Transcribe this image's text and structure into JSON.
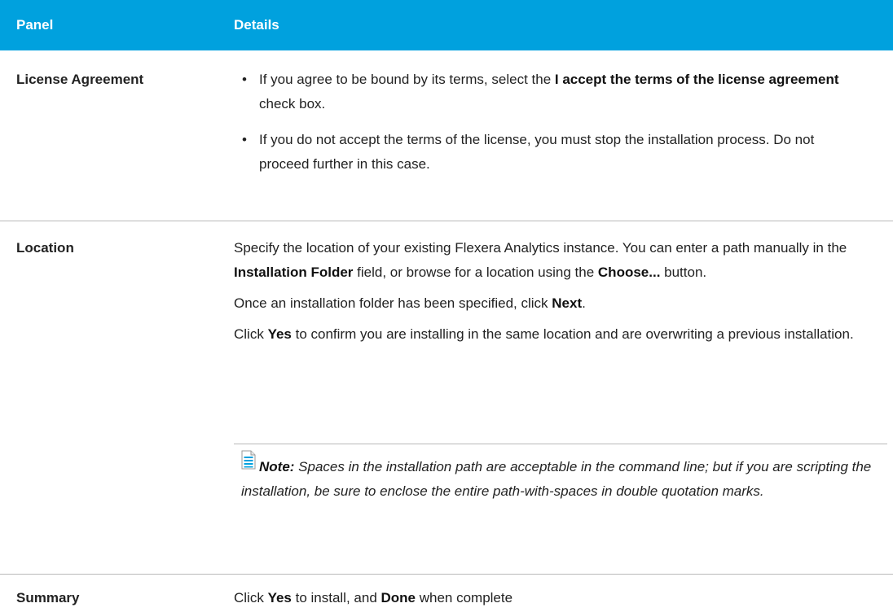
{
  "table": {
    "header": {
      "panel": "Panel",
      "details": "Details"
    },
    "rows": [
      {
        "panel": "License Agreement",
        "bullets": [
          {
            "bullet": "•",
            "t1": "If you agree to be bound by its terms, select the ",
            "b1": "I accept the terms of the license agreement",
            "t2": " check box."
          },
          {
            "bullet": "•",
            "t1": "If you do not accept the terms of the license, you must stop the installation process. Do not proceed further in this case."
          }
        ]
      },
      {
        "panel": "Location",
        "paragraphs": [
          {
            "t1": "Specify the location of your existing Flexera Analytics instance. You can enter a path manually in the ",
            "b1": "Installation Folder",
            "t2": " field, or browse for a location using the ",
            "b2": "Choose...",
            "t3": " button."
          },
          {
            "t1": "Once an installation folder has been specified, click ",
            "b1": "Next",
            "t2": "."
          },
          {
            "t1": "Click ",
            "b1": "Yes",
            "t2": " to confirm you are installing in the same location and are overwriting a previous installation."
          }
        ],
        "note": {
          "icon": "note-document-icon",
          "label": "Note:",
          "text": " Spaces in the installation path are acceptable in the command line; but if you are scripting the installation, be sure to enclose the entire path-with-spaces in double quotation marks."
        }
      },
      {
        "panel": "Summary",
        "line": {
          "t1": "Click ",
          "b1": "Yes",
          "t2": " to install, and ",
          "b2": "Done",
          "t3": " when complete"
        }
      }
    ]
  },
  "colors": {
    "header_bg": "#00a1de",
    "header_text": "#ffffff",
    "divider": "#b9b9b9"
  }
}
